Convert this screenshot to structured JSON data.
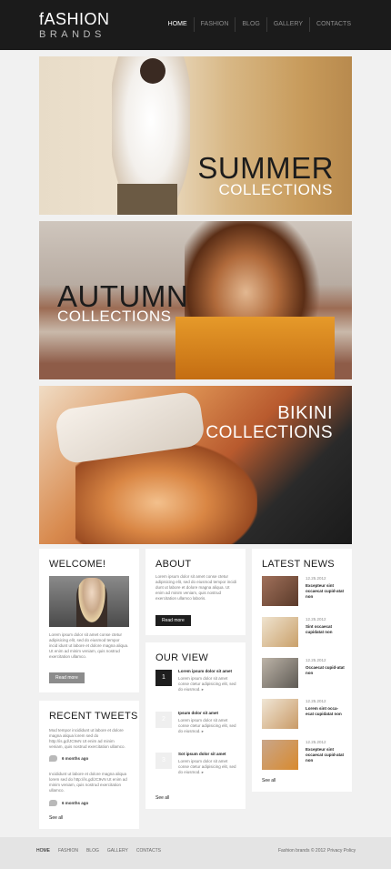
{
  "header": {
    "logo_line1": "fASHION",
    "logo_line2": "BRANDS",
    "nav": [
      "HOME",
      "FASHION",
      "BLOG",
      "GALLERY",
      "CONTACTS"
    ]
  },
  "banners": [
    {
      "title": "SUMMER",
      "subtitle": "COLLECTIONS"
    },
    {
      "title": "AUTUMN",
      "subtitle": "COLLECTIONS"
    },
    {
      "title": "BIKINI",
      "subtitle": "COLLECTIONS"
    }
  ],
  "welcome": {
    "title": "WELCOME!",
    "text": "Lorem ipsum dolor sit amet conse ctetur adipisicing elit, sed do eiusmod tempor incid idunt ut labore et dolore magna aliqua. Ut enim ad minim veniam, quis nostrud exercitation ullamco.",
    "button": "Read more"
  },
  "tweets": {
    "title": "RECENT TWEETS",
    "items": [
      {
        "text": "Mod tempor incididunt ut labore et dolore magna aliqua lorem sed do http://is.gd/JC9vN Ut enim ad minim veniam, quis nostrud exercitation ullamco.",
        "time": "6 months ago"
      },
      {
        "text": "Incididunt ut labore et dolore magna aliqua lorem sed do http://is.gd/JC9vN Ut enim ad minim veniam, quis nostrud exercitation ullamco.",
        "time": "6 months ago"
      }
    ],
    "see_all": "See all"
  },
  "about": {
    "title": "ABOUT",
    "text": "Lorem ipsum dolor sit amet conse ctetur adipisicing elit, sed do eiusmod tempor incidi dunt ut labore et dolore magna aliqua. Ut enim ad minim veniam, quis nostrud exercitation ullamco laboris.",
    "button": "Read more"
  },
  "ourview": {
    "title": "OUR VIEW",
    "items": [
      {
        "num": "1",
        "title": "Lorem ipsum dolor sit amet",
        "text": "Lorem ipsum dolor sit amet conse ctetur adipisicing elit, sed do eiusmod. ▸"
      },
      {
        "num": "2",
        "title": "Ipsum dolor sit amet",
        "text": "Lorem ipsum dolor sit amet conse ctetur adipisicing elit, sed do eiusmod. ▸"
      },
      {
        "num": "3",
        "title": "Sot ipsum dolor sit amet",
        "text": "Lorem ipsum dolor sit amet conse ctetur adipisicing elit, sed do eiusmod. ▸"
      }
    ],
    "see_all": "See all"
  },
  "news": {
    "title": "LATEST NEWS",
    "items": [
      {
        "date": "12.25.2012",
        "title": "Excepteur sint occaecat cupid-atat non"
      },
      {
        "date": "12.25.2012",
        "title": "Sint occaecat cupidatat non"
      },
      {
        "date": "12.25.2012",
        "title": "Occaecat cupid-atat non"
      },
      {
        "date": "12.25.2012",
        "title": "Lorem sint occa-ecat cupidatat non"
      },
      {
        "date": "12.25.2012",
        "title": "Excepteur sint occaecat cupid-atat non"
      }
    ],
    "see_all": "See all"
  },
  "footer": {
    "nav": [
      "HOME",
      "FASHION",
      "BLOG",
      "GALLERY",
      "CONTACTS"
    ],
    "copyright": "Fashion brands © 2012",
    "privacy": "Privacy Policy"
  },
  "colors": {
    "header_bg": "#1b1b1b",
    "page_bg": "#f1f1f1",
    "dark_button": "#1e1e1e",
    "grey_button": "#8c8c8c"
  }
}
